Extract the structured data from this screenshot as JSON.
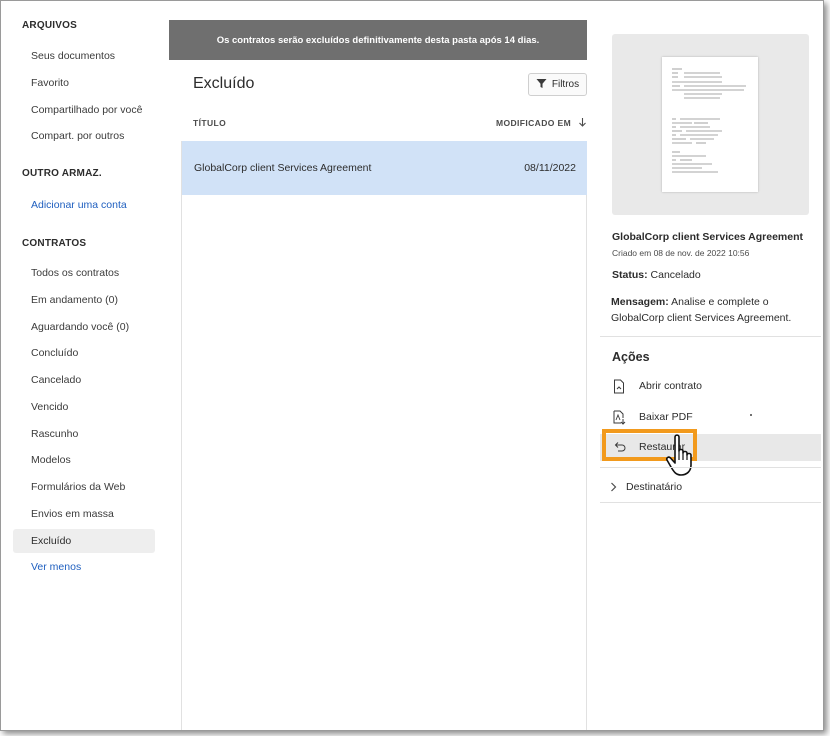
{
  "sidebar": {
    "arquivos_heading": "ARQUIVOS",
    "arquivos_items": [
      {
        "label": "Seus documentos"
      },
      {
        "label": "Favorito"
      },
      {
        "label": "Compartilhado por você"
      },
      {
        "label": "Compart. por outros"
      }
    ],
    "outro_heading": "OUTRO ARMAZ.",
    "add_account_label": "Adicionar uma conta",
    "contratos_heading": "CONTRATOS",
    "contratos_items": [
      {
        "label": "Todos os contratos"
      },
      {
        "label": "Em andamento (0)"
      },
      {
        "label": "Aguardando você (0)"
      },
      {
        "label": "Concluído"
      },
      {
        "label": "Cancelado"
      },
      {
        "label": "Vencido"
      },
      {
        "label": "Rascunho"
      },
      {
        "label": "Modelos"
      },
      {
        "label": "Formulários da Web"
      },
      {
        "label": "Envios em massa"
      },
      {
        "label": "Excluído"
      }
    ],
    "see_less_label": "Ver menos"
  },
  "banner": {
    "text": "Os contratos serão excluídos definitivamente desta pasta após 14 dias."
  },
  "list": {
    "title": "Excluído",
    "filter_label": "Filtros",
    "col_title": "TÍTULO",
    "col_modified": "MODIFICADO EM",
    "rows": [
      {
        "title": "GlobalCorp client Services Agreement",
        "date": "08/11/2022"
      }
    ]
  },
  "detail": {
    "title": "GlobalCorp client Services Agreement",
    "created": "Criado em 08 de nov. de 2022 10:56",
    "status_label": "Status:",
    "status_value": "Cancelado",
    "message_label": "Mensagem:",
    "message_value": "Analise e complete o GlobalCorp client Services Agreement.",
    "actions_heading": "Ações",
    "actions": [
      {
        "label": "Abrir contrato",
        "icon": "document-icon"
      },
      {
        "label": "Baixar PDF",
        "icon": "pdf-download-icon"
      },
      {
        "label": "Restaurar",
        "icon": "undo-icon"
      }
    ],
    "recipient_label": "Destinatário"
  },
  "colors": {
    "selected_row": "#d1e2f7",
    "banner_bg": "#6f6f6f",
    "link": "#1f5fbf",
    "highlight": "#f29a1d"
  }
}
